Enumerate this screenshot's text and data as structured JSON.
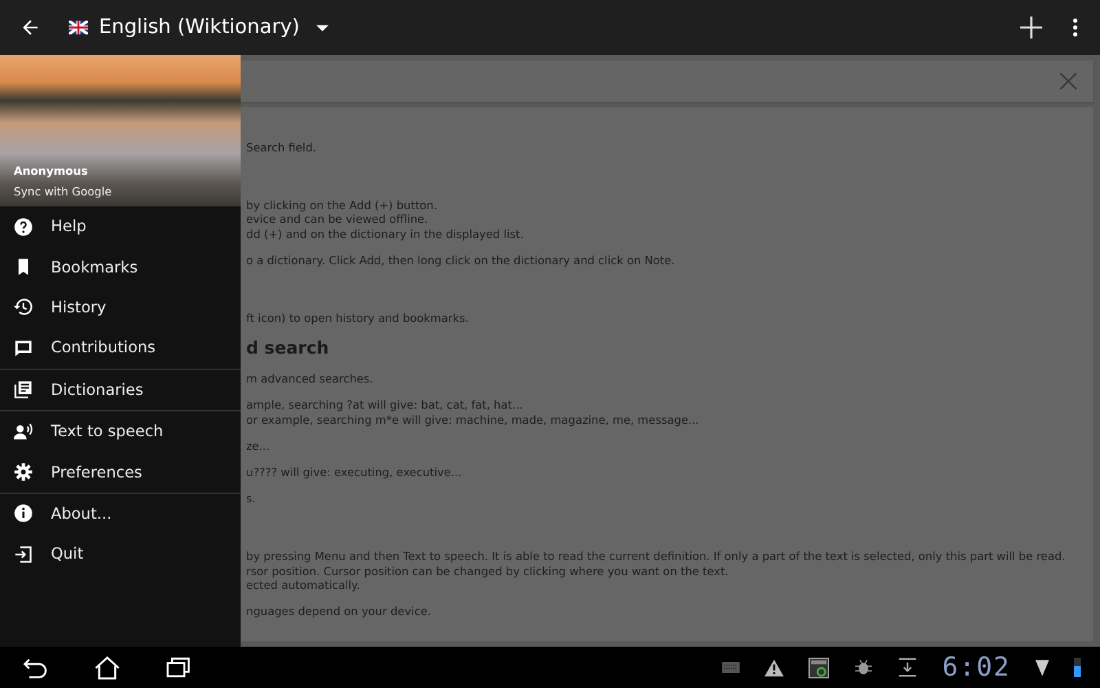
{
  "app_bar": {
    "title": "English (Wiktionary)"
  },
  "drawer": {
    "user_name": "Anonymous",
    "sync_label": "Sync with Google",
    "items": [
      {
        "label": "Help",
        "divider_after": false
      },
      {
        "label": "Bookmarks",
        "divider_after": false
      },
      {
        "label": "History",
        "divider_after": false
      },
      {
        "label": "Contributions",
        "divider_after": true
      },
      {
        "label": "Dictionaries",
        "divider_after": true
      },
      {
        "label": "Text to speech",
        "divider_after": false
      },
      {
        "label": "Preferences",
        "divider_after": true
      },
      {
        "label": "About...",
        "divider_after": false
      },
      {
        "label": "Quit",
        "divider_after": false
      }
    ]
  },
  "content": {
    "paragraphs": [
      {
        "kind": "text",
        "lines": [
          "Search field."
        ]
      },
      {
        "kind": "text",
        "lines": [
          "by clicking on the Add (+) button.",
          "evice and can be viewed offline.",
          "dd (+) and on the dictionary in the displayed list."
        ]
      },
      {
        "kind": "text",
        "lines": [
          "o a dictionary. Click Add, then long click on the dictionary and click on Note."
        ]
      },
      {
        "kind": "text",
        "lines": [
          "ft icon) to open history and bookmarks."
        ]
      },
      {
        "kind": "heading",
        "lines": [
          "d search"
        ]
      },
      {
        "kind": "text",
        "lines": [
          "m advanced searches."
        ]
      },
      {
        "kind": "text",
        "lines": [
          "ample, searching ?at will give: bat, cat, fat, hat...",
          "or example, searching m*e will give: machine, made, magazine, me, message..."
        ]
      },
      {
        "kind": "text",
        "lines": [
          "ze..."
        ]
      },
      {
        "kind": "text",
        "lines": [
          "u???? will give: executing, executive..."
        ]
      },
      {
        "kind": "text",
        "lines": [
          "s."
        ]
      },
      {
        "kind": "text",
        "lines": [
          "by pressing Menu and then Text to speech. It is able to read the current definition. If only a part of the text is selected, only this part will be read.",
          "rsor position. Cursor position can be changed by clicking where you want on the text.",
          "ected automatically."
        ]
      },
      {
        "kind": "text",
        "lines": [
          "nguages depend on your device."
        ]
      }
    ]
  },
  "status_bar": {
    "time": "6:02"
  }
}
